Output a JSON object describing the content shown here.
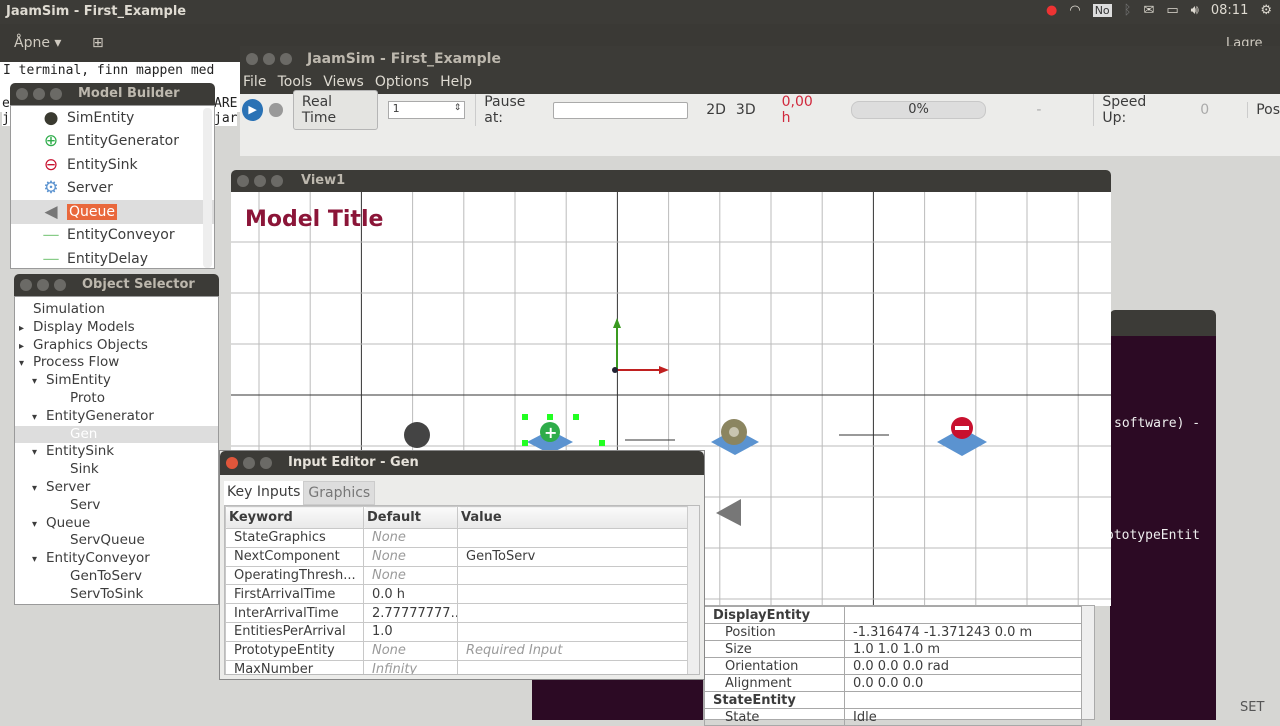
{
  "topbar": {
    "title": "JaamSim - First_Example",
    "keyboard": "No",
    "clock": "08:11"
  },
  "gedit": {
    "open_label": "Åpne",
    "save_label": "Lagre"
  },
  "terminal_bg": {
    "line1": "I terminal, finn mappen med",
    "line2a": "e",
    "line2b": "ARE",
    "line3a": "j",
    "line3b": "jar",
    "line4": "software) -",
    "line5": "ototypeEntit",
    "status": "SET"
  },
  "main": {
    "title": "JaamSim - First_Example",
    "menu": [
      "File",
      "Tools",
      "Views",
      "Options",
      "Help"
    ],
    "toolbar": {
      "real_time": "Real Time",
      "speed_value": "1",
      "pause_at": "Pause at:",
      "pause_value": "",
      "mode_2d": "2D",
      "mode_3d": "3D",
      "sim_time": "0,00 h",
      "progress_percent": 0,
      "progress_label": "0%",
      "remaining": "-",
      "speed_up_label": "Speed Up:",
      "speed_up_value": "0",
      "pos_label": "Pos"
    }
  },
  "model_builder": {
    "title": "Model Builder",
    "items": [
      "SimEntity",
      "EntityGenerator",
      "EntitySink",
      "Server",
      "Queue",
      "EntityConveyor",
      "EntityDelay"
    ],
    "selected": "Queue"
  },
  "object_selector": {
    "title": "Object Selector",
    "tree": [
      {
        "label": "Simulation",
        "level": 0,
        "arrow": ""
      },
      {
        "label": "Display Models",
        "level": 0,
        "arrow": "▸"
      },
      {
        "label": "Graphics Objects",
        "level": 0,
        "arrow": "▸"
      },
      {
        "label": "Process Flow",
        "level": 0,
        "arrow": "▾"
      },
      {
        "label": "SimEntity",
        "level": 1,
        "arrow": "▾"
      },
      {
        "label": "Proto",
        "level": 2,
        "arrow": ""
      },
      {
        "label": "EntityGenerator",
        "level": 1,
        "arrow": "▾"
      },
      {
        "label": "Gen",
        "level": 2,
        "arrow": "",
        "selected": true
      },
      {
        "label": "EntitySink",
        "level": 1,
        "arrow": "▾"
      },
      {
        "label": "Sink",
        "level": 2,
        "arrow": ""
      },
      {
        "label": "Server",
        "level": 1,
        "arrow": "▾"
      },
      {
        "label": "Serv",
        "level": 2,
        "arrow": ""
      },
      {
        "label": "Queue",
        "level": 1,
        "arrow": "▾"
      },
      {
        "label": "ServQueue",
        "level": 2,
        "arrow": ""
      },
      {
        "label": "EntityConveyor",
        "level": 1,
        "arrow": "▾"
      },
      {
        "label": "GenToServ",
        "level": 2,
        "arrow": ""
      },
      {
        "label": "ServToSink",
        "level": 2,
        "arrow": ""
      }
    ]
  },
  "view": {
    "title": "View1",
    "model_title": "Model Title",
    "model_title_color": "#8b1538"
  },
  "input_editor": {
    "title": "Input Editor - Gen",
    "tabs": [
      "Key Inputs",
      "Graphics"
    ],
    "headers": [
      "Keyword",
      "Default",
      "Value"
    ],
    "rows": [
      {
        "k": "StateGraphics",
        "d": "None",
        "v": "",
        "d_italic": true
      },
      {
        "k": "NextComponent",
        "d": "None",
        "v": "GenToServ",
        "d_italic": true
      },
      {
        "k": "OperatingThresh...",
        "d": "None",
        "v": "",
        "d_italic": true
      },
      {
        "k": "FirstArrivalTime",
        "d": "0.0 h",
        "v": ""
      },
      {
        "k": "InterArrivalTime",
        "d": "2.77777777...",
        "v": ""
      },
      {
        "k": "EntitiesPerArrival",
        "d": "1.0",
        "v": ""
      },
      {
        "k": "PrototypeEntity",
        "d": "None",
        "v": "Required Input",
        "d_italic": true,
        "v_italic": true
      },
      {
        "k": "MaxNumber",
        "d": "Infinity",
        "v": "",
        "d_italic": true
      }
    ]
  },
  "properties": {
    "rows": [
      {
        "k": "DisplayEntity",
        "v": "",
        "header": true
      },
      {
        "k": "Position",
        "v": "-1.316474 -1.371243 0.0 m"
      },
      {
        "k": "Size",
        "v": "1.0 1.0 1.0 m"
      },
      {
        "k": "Orientation",
        "v": "0.0 0.0 0.0 rad"
      },
      {
        "k": "Alignment",
        "v": "0.0 0.0 0.0"
      },
      {
        "k": "StateEntity",
        "v": "",
        "header": true
      },
      {
        "k": "State",
        "v": "Idle"
      }
    ]
  }
}
